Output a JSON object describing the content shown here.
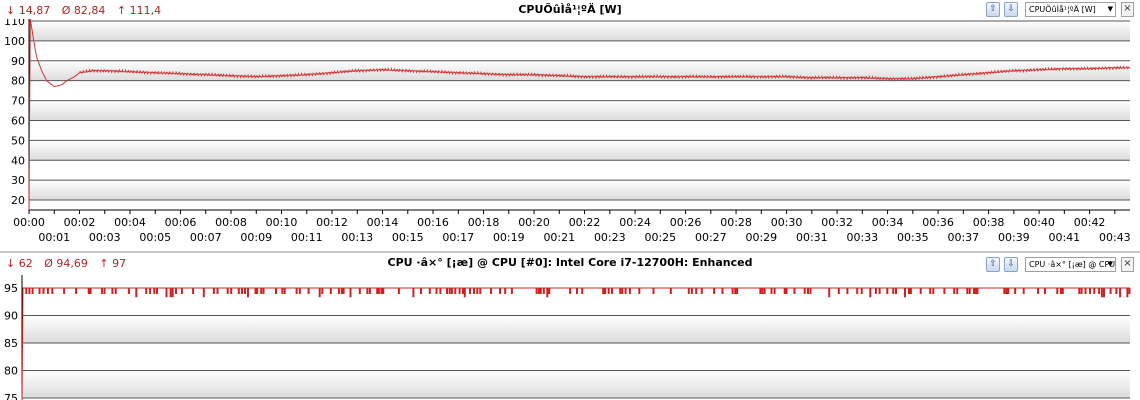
{
  "panels": [
    {
      "stats": {
        "min": "↓ 14,87",
        "avg": "Ø 82,84",
        "max": "↑ 111,4"
      },
      "title": "CPUÕûÌå¹¦ºÄ [W]",
      "controls": {
        "combo_label": "CPUÕûÌå¹¦ºÄ [W]",
        "btn_up_icon": "scroll-up-icon",
        "btn_down_icon": "scroll-down-icon"
      },
      "line_color": "#cc3333",
      "chart_data": {
        "type": "line",
        "title": "CPUÕûÌå¹¦ºÄ [W]",
        "ylim": [
          15,
          111
        ],
        "yticks": [
          20,
          30,
          40,
          50,
          60,
          70,
          80,
          90,
          100,
          110
        ],
        "xticks_top": [
          "00:00",
          "00:02",
          "00:04",
          "00:06",
          "00:08",
          "00:10",
          "00:12",
          "00:14",
          "00:16",
          "00:18",
          "00:20",
          "00:22",
          "00:24",
          "00:26",
          "00:28",
          "00:30",
          "00:32",
          "00:34",
          "00:36",
          "00:38",
          "00:40",
          "00:42"
        ],
        "xticks_bottom": [
          "00:01",
          "00:03",
          "00:05",
          "00:07",
          "00:09",
          "00:11",
          "00:13",
          "00:15",
          "00:17",
          "00:19",
          "00:21",
          "00:23",
          "00:25",
          "00:27",
          "00:29",
          "00:31",
          "00:33",
          "00:35",
          "00:37",
          "00:39",
          "00:41",
          "00:43"
        ],
        "x_minutes": [
          0,
          0.05,
          0.1,
          0.2,
          0.3,
          0.5,
          0.7,
          1,
          1.3,
          1.5,
          1.8,
          2,
          2.5,
          3,
          4,
          5,
          6,
          7,
          8,
          9,
          10,
          11,
          12,
          13,
          14,
          15,
          16,
          17,
          18,
          19,
          20,
          21,
          22,
          23,
          24,
          25,
          26,
          27,
          28,
          29,
          30,
          31,
          32,
          33,
          34,
          35,
          36,
          37,
          38,
          39,
          40,
          41,
          42,
          43,
          43.6
        ],
        "y": [
          15,
          111,
          107,
          99,
          92,
          85,
          80,
          77,
          78,
          80,
          82,
          84,
          85,
          85,
          84.5,
          84,
          83.5,
          83,
          82.5,
          82,
          82.5,
          83,
          84,
          85,
          85.5,
          85,
          84.5,
          84,
          83.5,
          83,
          83,
          82.5,
          82,
          82,
          82,
          82,
          82,
          82,
          82,
          82,
          82,
          81.5,
          81.5,
          81.5,
          81,
          81,
          82,
          83,
          84,
          85,
          85.5,
          86,
          86,
          86.5,
          86.5
        ]
      }
    },
    {
      "stats": {
        "min": "↓ 62",
        "avg": "Ø 94,69",
        "max": "↑ 97"
      },
      "title": "CPU ·â×° [¡æ] @ CPU [#0]: Intel Core i7-12700H: Enhanced",
      "controls": {
        "combo_label": "CPU ·â×° [¡æ] @ CPU [#",
        "btn_up_icon": "scroll-up-icon",
        "btn_down_icon": "scroll-down-icon"
      },
      "line_color": "#cc2222",
      "chart_data": {
        "type": "line",
        "title": "CPU ·â×° [¡æ] @ CPU [#0]: Intel Core i7-12700H: Enhanced",
        "ylim": [
          75,
          97
        ],
        "yticks": [
          75,
          80,
          85,
          90,
          95
        ],
        "baseline": 95,
        "dip_to": 94,
        "start_min": 62
      }
    }
  ]
}
